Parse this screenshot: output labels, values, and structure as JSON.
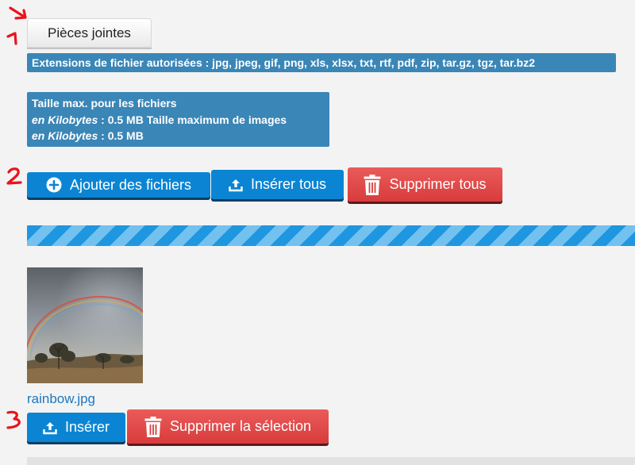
{
  "attachments": {
    "tab_label": "Pièces jointes",
    "allowed_extensions_text": "Extensions de fichier autorisées : jpg, jpeg, gif, png, xls, xlsx, txt, rtf, pdf, zip, tar.gz, tgz, tar.bz2",
    "size_info": {
      "title": "Taille max. pour les fichiers",
      "unit_label_1": "en Kilobytes",
      "line_2_rest": " : 0.5 MB Taille maximum de images",
      "unit_label_2": "en Kilobytes",
      "line_3_rest": " : 0.5 MB"
    }
  },
  "toolbar": {
    "add_files_label": "Ajouter des fichiers",
    "insert_all_label": "Insérer tous",
    "delete_all_label": "Supprimer tous"
  },
  "upload": {
    "progress": 1.0
  },
  "file_item": {
    "filename": "rainbow.jpg",
    "insert_label": "Insérer",
    "delete_selection_label": "Supprimer la sélection"
  },
  "annotations": [
    "1",
    "2",
    "3"
  ],
  "colors": {
    "primary_button": "#0b85d3",
    "danger_button": "#e04a4a",
    "info_box": "#3a86b7",
    "annotation": "#e8141b",
    "link": "#1a78c2"
  }
}
